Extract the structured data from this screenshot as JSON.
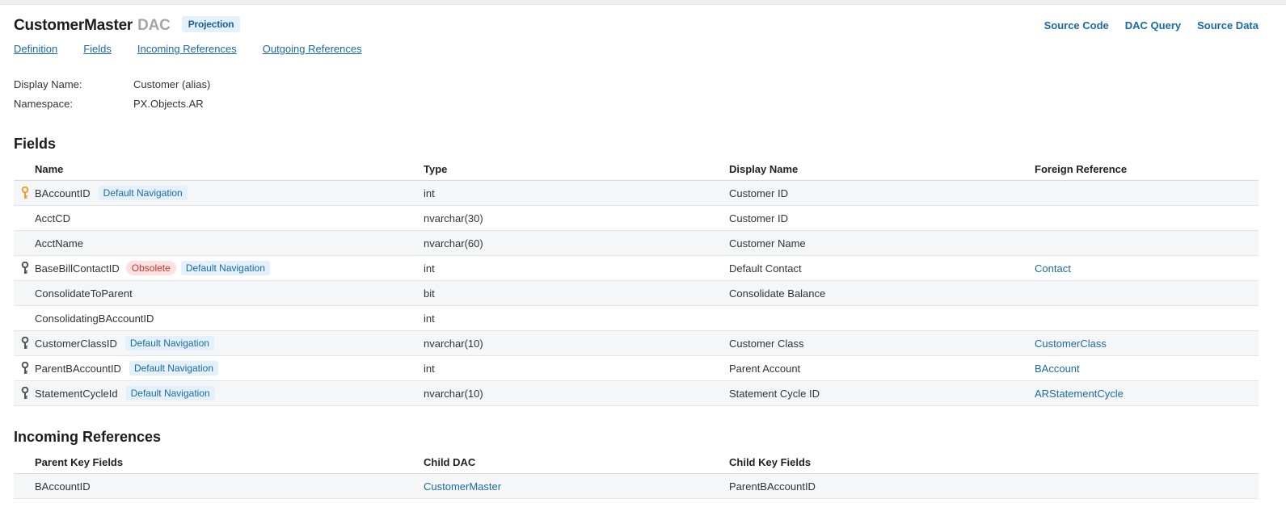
{
  "header": {
    "title": "CustomerMaster",
    "title_suffix": "DAC",
    "badge": "Projection",
    "links": [
      "Source Code",
      "DAC Query",
      "Source Data"
    ]
  },
  "tabs": [
    "Definition",
    "Fields",
    "Incoming References",
    "Outgoing References"
  ],
  "meta": [
    {
      "label": "Display Name:",
      "value": "Customer (alias)"
    },
    {
      "label": "Namespace:",
      "value": "PX.Objects.AR"
    }
  ],
  "fields": {
    "heading": "Fields",
    "columns": [
      "Name",
      "Type",
      "Display Name",
      "Foreign Reference"
    ],
    "rows": [
      {
        "name": "BAccountID",
        "key": "primary",
        "obsolete": "",
        "nav": "Default Navigation",
        "type": "int",
        "display": "Customer ID",
        "ref": ""
      },
      {
        "name": "AcctCD",
        "key": "",
        "obsolete": "",
        "nav": "",
        "type": "nvarchar(30)",
        "display": "Customer ID",
        "ref": ""
      },
      {
        "name": "AcctName",
        "key": "",
        "obsolete": "",
        "nav": "",
        "type": "nvarchar(60)",
        "display": "Customer Name",
        "ref": ""
      },
      {
        "name": "BaseBillContactID",
        "key": "foreign",
        "obsolete": "Obsolete",
        "nav": "Default Navigation",
        "type": "int",
        "display": "Default Contact",
        "ref": "Contact"
      },
      {
        "name": "ConsolidateToParent",
        "key": "",
        "obsolete": "",
        "nav": "",
        "type": "bit",
        "display": "Consolidate Balance",
        "ref": ""
      },
      {
        "name": "ConsolidatingBAccountID",
        "key": "",
        "obsolete": "",
        "nav": "",
        "type": "int",
        "display": "",
        "ref": ""
      },
      {
        "name": "CustomerClassID",
        "key": "foreign",
        "obsolete": "",
        "nav": "Default Navigation",
        "type": "nvarchar(10)",
        "display": "Customer Class",
        "ref": "CustomerClass"
      },
      {
        "name": "ParentBAccountID",
        "key": "foreign",
        "obsolete": "",
        "nav": "Default Navigation",
        "type": "int",
        "display": "Parent Account",
        "ref": "BAccount"
      },
      {
        "name": "StatementCycleId",
        "key": "foreign",
        "obsolete": "",
        "nav": "Default Navigation",
        "type": "nvarchar(10)",
        "display": "Statement Cycle ID",
        "ref": "ARStatementCycle"
      }
    ]
  },
  "incoming": {
    "heading": "Incoming References",
    "columns": [
      "Parent Key Fields",
      "Child DAC",
      "Child Key Fields"
    ],
    "rows": [
      {
        "parent_key": "BAccountID",
        "child_dac": "CustomerMaster",
        "child_key": "ParentBAccountID"
      }
    ]
  },
  "colors": {
    "link": "#1a6aa8",
    "primary_key": "#f0a030",
    "foreign_key": "#555555",
    "obsolete_bg": "#fde0e0",
    "obsolete_text": "#c0392b",
    "nav_bg": "#e4f1fb"
  },
  "icons": {
    "primary_key": "key-icon",
    "foreign_key": "key-icon"
  }
}
